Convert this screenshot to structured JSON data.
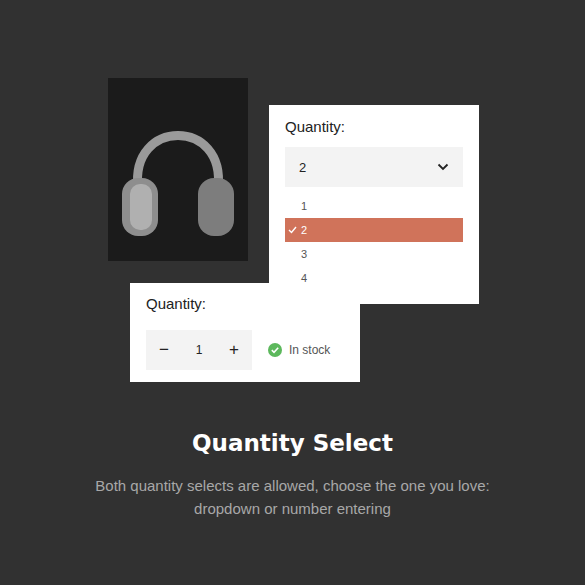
{
  "dropdown": {
    "label": "Quantity:",
    "value": "2",
    "expanded": true,
    "options": [
      {
        "label": "1",
        "selected": false
      },
      {
        "label": "2",
        "selected": true
      },
      {
        "label": "3",
        "selected": false
      },
      {
        "label": "4",
        "selected": false
      }
    ]
  },
  "stepper": {
    "label": "Quantity:",
    "decrement": "−",
    "value": "1",
    "increment": "+",
    "stock": {
      "label": "In stock",
      "in_stock": true
    }
  },
  "title": "Quantity Select",
  "description": "Both quantity selects are allowed, choose the one you love: dropdown or number entering"
}
